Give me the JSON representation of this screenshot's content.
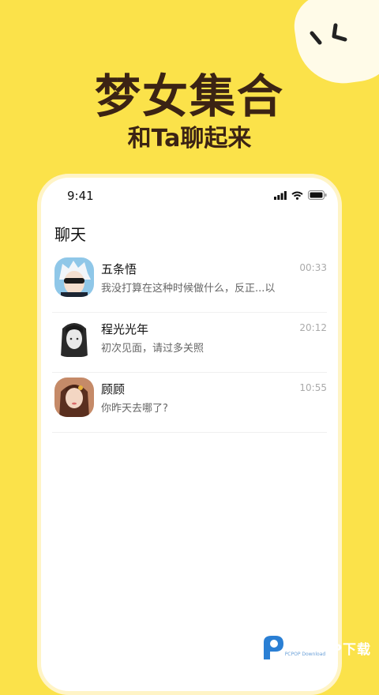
{
  "headline": "梦女集合",
  "subline": "和Ta聊起来",
  "status_bar": {
    "time": "9:41"
  },
  "screen_title": "聊天",
  "chats": [
    {
      "name": "五条悟",
      "preview": "我没打算在这种时候做什么，反正...以后多的...",
      "time": "00:33",
      "avatar": "avatar-gojo"
    },
    {
      "name": "程光光年",
      "preview": "初次见面，请过多关照",
      "time": "20:12",
      "avatar": "avatar-dark-hair"
    },
    {
      "name": "顾顾",
      "preview": "你昨天去哪了?",
      "time": "10:55",
      "avatar": "avatar-girl"
    }
  ],
  "watermark": {
    "brand": "PCPOP下载",
    "sub": "PCPOP Download"
  },
  "colors": {
    "background": "#fbe24a",
    "headline": "#3b2314",
    "phone_border": "#fff4c6"
  }
}
